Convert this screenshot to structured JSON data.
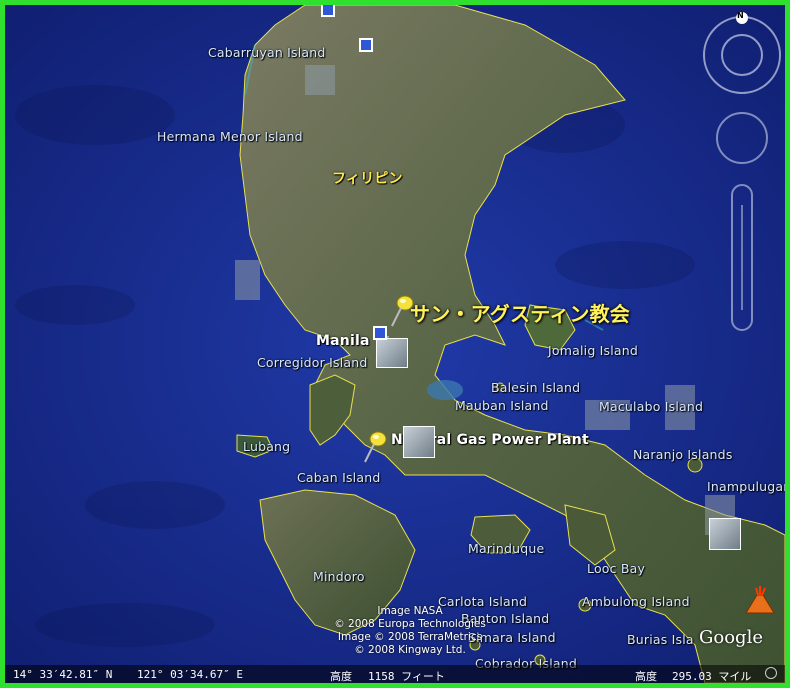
{
  "map": {
    "country_label": "フィリピン",
    "places": [
      {
        "id": "san-agustin",
        "label": "サン・アグスティン教会"
      },
      {
        "id": "gas-plant",
        "label": "Natural Gas Power Plant"
      }
    ],
    "city": "Manila",
    "islands": [
      "Cabarruyan Island",
      "Hermana Menor Island",
      "Corregidor Island",
      "Jomalig Island",
      "Balesin Island",
      "Mauban Island",
      "Maculabo Island",
      "Lubang",
      "Caban Island",
      "Naranjo Islands",
      "Inampulugan",
      "Marinduque",
      "Mindoro",
      "Looc Bay",
      "Carlota Island",
      "Banton Island",
      "Simara Island",
      "Ambulong Island",
      "Burias Isla",
      "Cobrador Island"
    ],
    "colors": {
      "ocean": "#1a2c8c",
      "land": "#5c6a48",
      "border": "#e8e050",
      "frame": "#2fe02f"
    }
  },
  "attribution": {
    "line1": "Image NASA",
    "line2": "© 2008 Europa Technologies",
    "line3": "Image © 2008 TerraMetrics",
    "line4": "© 2008 Kingway Ltd."
  },
  "status": {
    "lat": "14° 33′42.81″ N",
    "lon": "121° 03′34.67″ E",
    "elev_label": "高度",
    "elev_value": "1158 フィート",
    "eye_label": "高度",
    "eye_value": "295.03 マイル"
  },
  "nav": {
    "north": "N"
  },
  "logo": "Google"
}
